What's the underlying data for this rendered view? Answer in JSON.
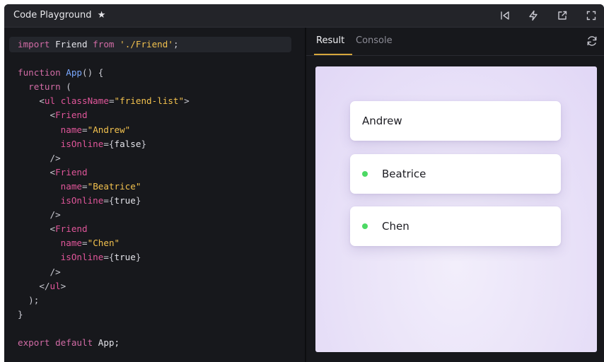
{
  "window": {
    "title": "Code Playground",
    "unsaved_marker": "★",
    "toolbar_icons": [
      "reset-icon",
      "format-icon",
      "open-external-icon",
      "fullscreen-icon"
    ]
  },
  "editor": {
    "lines": [
      [
        {
          "t": "import",
          "c": "keyword"
        },
        {
          "t": " Friend ",
          "c": "plain"
        },
        {
          "t": "from",
          "c": "keyword"
        },
        {
          "t": " ",
          "c": "plain"
        },
        {
          "t": "'./Friend'",
          "c": "string"
        },
        {
          "t": ";",
          "c": "punct"
        }
      ],
      [],
      [
        {
          "t": "function",
          "c": "keyword"
        },
        {
          "t": " ",
          "c": "plain"
        },
        {
          "t": "App",
          "c": "func"
        },
        {
          "t": "() {",
          "c": "punct"
        }
      ],
      [
        {
          "t": "  return",
          "c": "keyword"
        },
        {
          "t": " (",
          "c": "punct"
        }
      ],
      [
        {
          "t": "    <",
          "c": "punct"
        },
        {
          "t": "ul",
          "c": "tag"
        },
        {
          "t": " ",
          "c": "plain"
        },
        {
          "t": "className",
          "c": "attr"
        },
        {
          "t": "=",
          "c": "punct"
        },
        {
          "t": "\"friend-list\"",
          "c": "string"
        },
        {
          "t": ">",
          "c": "punct"
        }
      ],
      [
        {
          "t": "      <",
          "c": "punct"
        },
        {
          "t": "Friend",
          "c": "tag"
        }
      ],
      [
        {
          "t": "        ",
          "c": "plain"
        },
        {
          "t": "name",
          "c": "attr"
        },
        {
          "t": "=",
          "c": "punct"
        },
        {
          "t": "\"Andrew\"",
          "c": "string"
        }
      ],
      [
        {
          "t": "        ",
          "c": "plain"
        },
        {
          "t": "isOnline",
          "c": "attr"
        },
        {
          "t": "={",
          "c": "punct"
        },
        {
          "t": "false",
          "c": "bool"
        },
        {
          "t": "}",
          "c": "punct"
        }
      ],
      [
        {
          "t": "      />",
          "c": "punct"
        }
      ],
      [
        {
          "t": "      <",
          "c": "punct"
        },
        {
          "t": "Friend",
          "c": "tag"
        }
      ],
      [
        {
          "t": "        ",
          "c": "plain"
        },
        {
          "t": "name",
          "c": "attr"
        },
        {
          "t": "=",
          "c": "punct"
        },
        {
          "t": "\"Beatrice\"",
          "c": "string"
        }
      ],
      [
        {
          "t": "        ",
          "c": "plain"
        },
        {
          "t": "isOnline",
          "c": "attr"
        },
        {
          "t": "={",
          "c": "punct"
        },
        {
          "t": "true",
          "c": "bool"
        },
        {
          "t": "}",
          "c": "punct"
        }
      ],
      [
        {
          "t": "      />",
          "c": "punct"
        }
      ],
      [
        {
          "t": "      <",
          "c": "punct"
        },
        {
          "t": "Friend",
          "c": "tag"
        }
      ],
      [
        {
          "t": "        ",
          "c": "plain"
        },
        {
          "t": "name",
          "c": "attr"
        },
        {
          "t": "=",
          "c": "punct"
        },
        {
          "t": "\"Chen\"",
          "c": "string"
        }
      ],
      [
        {
          "t": "        ",
          "c": "plain"
        },
        {
          "t": "isOnline",
          "c": "attr"
        },
        {
          "t": "={",
          "c": "punct"
        },
        {
          "t": "true",
          "c": "bool"
        },
        {
          "t": "}",
          "c": "punct"
        }
      ],
      [
        {
          "t": "      />",
          "c": "punct"
        }
      ],
      [
        {
          "t": "    </",
          "c": "punct"
        },
        {
          "t": "ul",
          "c": "tag"
        },
        {
          "t": ">",
          "c": "punct"
        }
      ],
      [
        {
          "t": "  );",
          "c": "punct"
        }
      ],
      [
        {
          "t": "}",
          "c": "punct"
        }
      ],
      [],
      [
        {
          "t": "export",
          "c": "keyword"
        },
        {
          "t": " ",
          "c": "plain"
        },
        {
          "t": "default",
          "c": "keyword"
        },
        {
          "t": " App;",
          "c": "plain"
        }
      ]
    ]
  },
  "result_panel": {
    "tabs": [
      {
        "label": "Result",
        "active": true
      },
      {
        "label": "Console",
        "active": false
      }
    ],
    "refresh_icon": "refresh-icon"
  },
  "preview": {
    "friends": [
      {
        "name": "Andrew",
        "online": false
      },
      {
        "name": "Beatrice",
        "online": true
      },
      {
        "name": "Chen",
        "online": true
      }
    ],
    "online_color": "#4cd964"
  },
  "colors": {
    "accent": "#d6a73c",
    "background": "#17181c"
  }
}
